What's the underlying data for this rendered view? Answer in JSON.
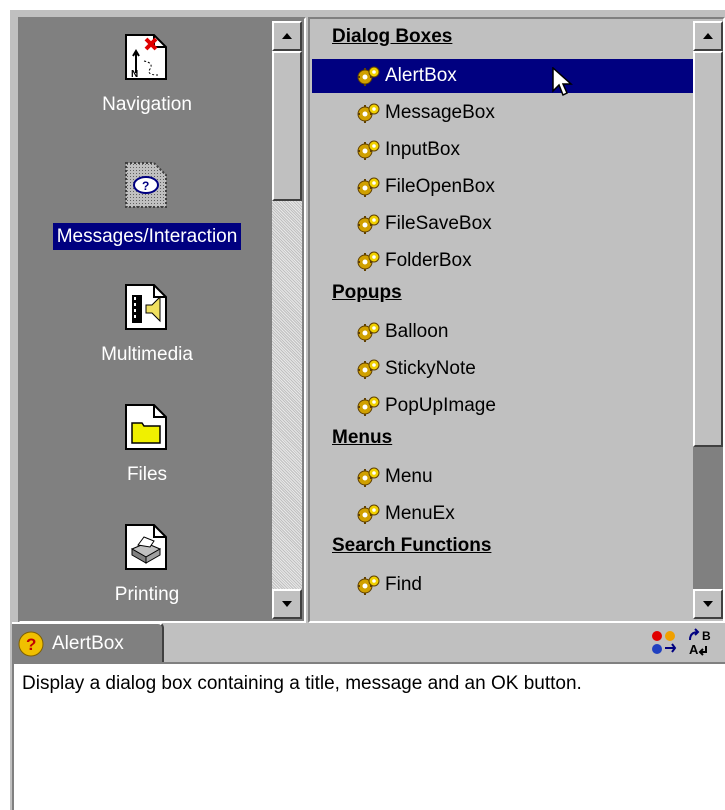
{
  "categories": [
    {
      "label": "Navigation",
      "icon": "navigation-icon",
      "selected": false
    },
    {
      "label": "Messages/Interaction",
      "icon": "messages-icon",
      "selected": true
    },
    {
      "label": "Multimedia",
      "icon": "multimedia-icon",
      "selected": false
    },
    {
      "label": "Files",
      "icon": "files-icon",
      "selected": false
    },
    {
      "label": "Printing",
      "icon": "printing-icon",
      "selected": false
    }
  ],
  "functions": {
    "groups": [
      {
        "header": "Dialog Boxes",
        "items": [
          "AlertBox",
          "MessageBox",
          "InputBox",
          "FileOpenBox",
          "FileSaveBox",
          "FolderBox"
        ]
      },
      {
        "header": "Popups",
        "items": [
          "Balloon",
          "StickyNote",
          "PopUpImage"
        ]
      },
      {
        "header": "Menus",
        "items": [
          "Menu",
          "MenuEx"
        ]
      },
      {
        "header": "Search Functions",
        "items": [
          "Find"
        ]
      }
    ],
    "selected": "AlertBox"
  },
  "detail": {
    "tab_title": "AlertBox",
    "description": "Display a dialog box containing a title, message and an OK button."
  },
  "colors": {
    "selection": "#000080",
    "panel": "#c0c0c0",
    "dark_panel": "#808080"
  }
}
